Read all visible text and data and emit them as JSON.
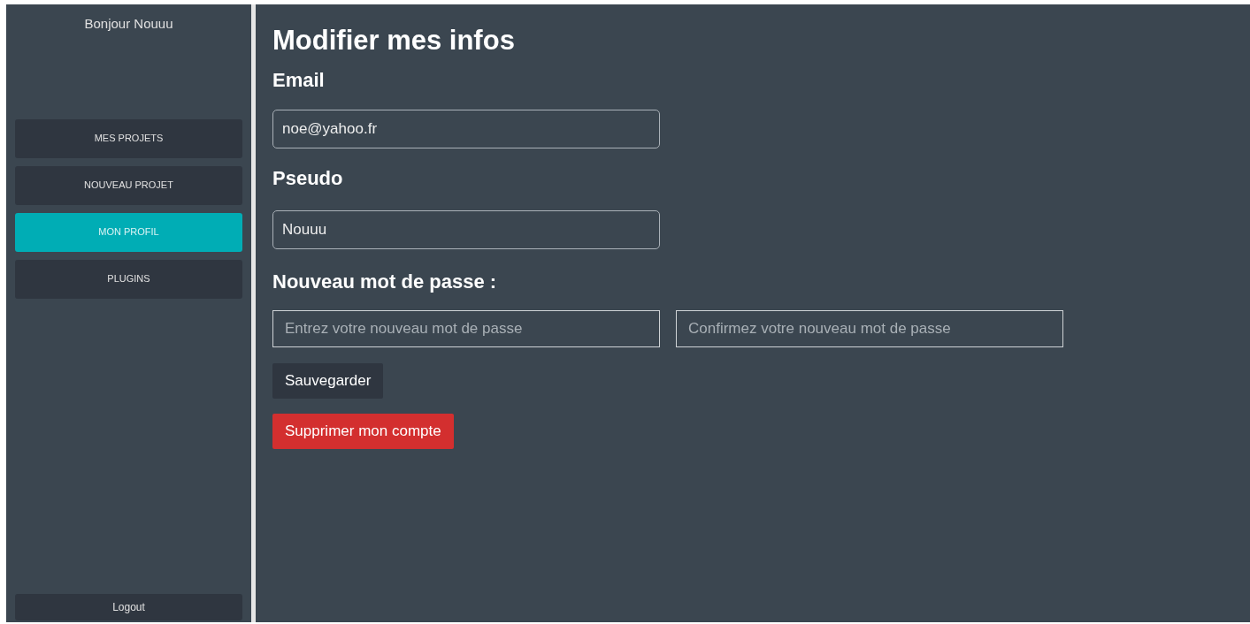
{
  "sidebar": {
    "greeting": "Bonjour Nouuu",
    "items": [
      {
        "label": "MES PROJETS",
        "selected": false
      },
      {
        "label": "NOUVEAU PROJET",
        "selected": false
      },
      {
        "label": "MON PROFIL",
        "selected": true
      },
      {
        "label": "PLUGINS",
        "selected": false
      }
    ],
    "logout": "Logout"
  },
  "main": {
    "title": "Modifier mes infos",
    "email": {
      "label": "Email",
      "value": "noe@yahoo.fr"
    },
    "pseudo": {
      "label": "Pseudo",
      "value": "Nouuu"
    },
    "password": {
      "label": "Nouveau mot de passe :",
      "fields": [
        {
          "placeholder": "Entrez votre nouveau mot de passe"
        },
        {
          "placeholder": "Confirmez votre nouveau mot de passe"
        }
      ]
    },
    "buttons": [
      {
        "kind": "save",
        "label": "Sauvegarder"
      },
      {
        "kind": "danger",
        "label": "Supprimer mon compte"
      }
    ]
  }
}
